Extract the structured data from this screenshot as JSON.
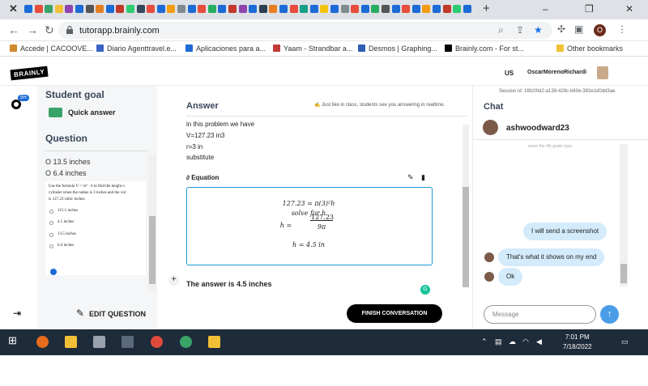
{
  "browser": {
    "url": "tutorapp.brainly.com",
    "profile_initial": "O",
    "window_controls": [
      "–",
      "❐",
      "✕"
    ],
    "new_tab": "+",
    "tab_close": "✕"
  },
  "bookmarks": [
    {
      "label": "Accede | CACOOVE...",
      "color": "#d08a2e"
    },
    {
      "label": "Diario Agenttravel.e...",
      "color": "#3a62c5"
    },
    {
      "label": "Aplicaciones para a...",
      "color": "#1c6bd6"
    },
    {
      "label": "Yaam - Strandbar a...",
      "color": "#c23a3a"
    },
    {
      "label": "Desmos | Graphing...",
      "color": "#2e5fb0"
    },
    {
      "label": "Brainly.com - For st...",
      "color": "#000000"
    },
    {
      "label": "Other bookmarks",
      "color": "#f2c037"
    }
  ],
  "brainly": {
    "logo": "BRAINLY",
    "lang": "US",
    "username": "OscarMorenoRichardi"
  },
  "left": {
    "timer_badge": "5H",
    "student_goal": "Student goal",
    "quick_answer": "Quick answer",
    "question_title": "Question",
    "options_lines": [
      "O 13.5 inches",
      "O 6.4 inches"
    ],
    "question_text": [
      "Use the formula V = πr² · h to find the height o",
      "cylinder when the radius is 3 inches and the vol",
      "is 127.23 cubic inches."
    ],
    "radio_options": [
      "115.1 inches",
      "4.5 inches",
      "13.5 inches",
      "6.4 inches"
    ],
    "edit_question": "EDIT QUESTION"
  },
  "answer": {
    "title": "Answer",
    "note": "✍ Just like in class, students see you answering in realtime.",
    "lines": [
      "in this problem we have",
      "V=127.23 in3",
      "r=3 in",
      "substitute"
    ],
    "equation_label": "Equation",
    "equation": {
      "line1": "127.23 = π(3)²h",
      "line2": "solve for h",
      "h_eq": "h =",
      "numerator": "127.23",
      "denominator": "9π",
      "result": "h = 4.5 in"
    },
    "final": "The answer is 4.5 inches",
    "finish": "FINISH CONVERSATION",
    "add": "+"
  },
  "chat": {
    "session": "Session id: 16fc00d2-a138-429c-b60e-392e1d0dd3ae",
    "title": "Chat",
    "user": "ashwoodward23",
    "faded_text": "exam the 4th grade type.",
    "messages": [
      {
        "from": "tutor",
        "text": "I will send a screenshot"
      },
      {
        "from": "student",
        "text": "That's what it shows on my end"
      },
      {
        "from": "student",
        "text": "Ok"
      }
    ],
    "placeholder": "Message",
    "send": "↑"
  },
  "taskbar": {
    "time": "7:01 PM",
    "date": "7/18/2022"
  }
}
